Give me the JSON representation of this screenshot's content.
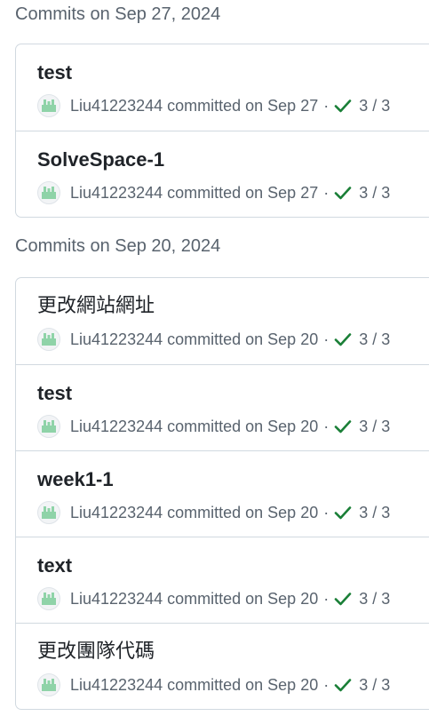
{
  "groups": [
    {
      "heading": "Commits on Sep 27, 2024",
      "commits": [
        {
          "title": "test",
          "author": "Liu41223244",
          "action": "committed on Sep 27",
          "separator": "·",
          "checks": "3 / 3"
        },
        {
          "title": "SolveSpace-1",
          "author": "Liu41223244",
          "action": "committed on Sep 27",
          "separator": "·",
          "checks": "3 / 3"
        }
      ]
    },
    {
      "heading": "Commits on Sep 20, 2024",
      "commits": [
        {
          "title": "更改網站網址",
          "author": "Liu41223244",
          "action": "committed on Sep 20",
          "separator": "·",
          "checks": "3 / 3"
        },
        {
          "title": "test",
          "author": "Liu41223244",
          "action": "committed on Sep 20",
          "separator": "·",
          "checks": "3 / 3"
        },
        {
          "title": "week1-1",
          "author": "Liu41223244",
          "action": "committed on Sep 20",
          "separator": "·",
          "checks": "3 / 3"
        },
        {
          "title": "text",
          "author": "Liu41223244",
          "action": "committed on Sep 20",
          "separator": "·",
          "checks": "3 / 3"
        },
        {
          "title": "更改團隊代碼",
          "author": "Liu41223244",
          "action": "committed on Sep 20",
          "separator": "·",
          "checks": "3 / 3"
        }
      ]
    }
  ],
  "icons": {
    "avatar": "identicon-avatar",
    "status": "check-icon"
  },
  "colors": {
    "check": "#1a7f37",
    "avatar": "#8fd3a8",
    "muted": "#59636e",
    "border": "#d1d9e0"
  }
}
